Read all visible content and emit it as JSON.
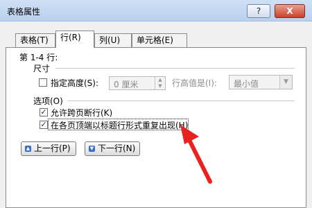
{
  "window": {
    "title": "表格属性",
    "help_glyph": "?",
    "close_glyph": "X"
  },
  "tabs": [
    {
      "label": "表格(T)"
    },
    {
      "label": "行(R)"
    },
    {
      "label": "列(U)"
    },
    {
      "label": "单元格(E)"
    }
  ],
  "row_tab": {
    "heading": "第 1-4 行:",
    "size_group": "尺寸",
    "specify_height": {
      "label": "指定高度(S):",
      "checked": false
    },
    "height_value": "0 厘米",
    "row_height_is_label": "行高值是(I):",
    "row_height_is_value": "最小值",
    "options_group": "选项(O)",
    "allow_break": {
      "label": "允许跨页断行(K)",
      "checked": true
    },
    "repeat_header": {
      "label": "在各页顶端以标题行形式重复出现(H)",
      "checked": true
    },
    "prev_row_button": "上一行(P)",
    "next_row_button": "下一行(N)"
  },
  "icons": {
    "prev": "up-arrow-icon",
    "next": "down-arrow-icon",
    "annotation": "red-pointer-arrow"
  },
  "colors": {
    "annotation_arrow": "#e8231f",
    "nav_icon": "#3a6fc4"
  }
}
